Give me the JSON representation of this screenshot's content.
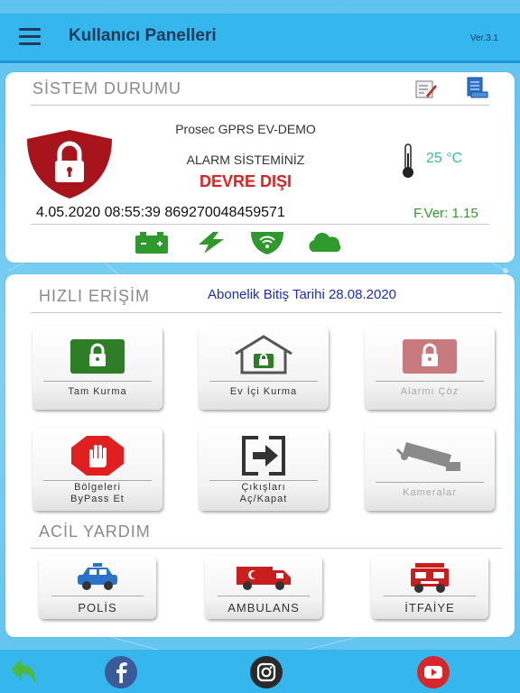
{
  "header": {
    "title": "Kullanıcı Panelleri",
    "version": "Ver.3.1"
  },
  "system_status": {
    "title": "SİSTEM DURUMU",
    "device_name": "Prosec GPRS EV-DEMO",
    "alarm_label": "ALARM SİSTEMİNİZ",
    "alarm_state": "DEVRE DIŞI",
    "temperature": "25 °C",
    "datetime_imei": "4.05.2020 08:55:39  869270048459571",
    "firmware": "F.Ver: 1.15",
    "icons": [
      "edit-icon",
      "report-icon",
      "battery-icon",
      "power-icon",
      "wifi-icon",
      "cloud-icon"
    ]
  },
  "quick_access": {
    "title": "HIZLI ERİŞİM",
    "expiry": "Abonelik Bitiş Tarihi 28.08.2020",
    "tiles": [
      {
        "label": "Tam Kurma"
      },
      {
        "label": "Ev İçi Kurma"
      },
      {
        "label": "Alarmı Çöz"
      },
      {
        "label_line1": "Bölgeleri",
        "label_line2": "ByPass Et"
      },
      {
        "label_line1": "Çıkışları",
        "label_line2": "Aç/Kapat"
      },
      {
        "label": "Kameralar"
      }
    ]
  },
  "emergency": {
    "title": "ACİL YARDIM",
    "buttons": [
      {
        "label": "POLİS"
      },
      {
        "label": "AMBULANS"
      },
      {
        "label": "İTFAİYE"
      }
    ]
  },
  "colors": {
    "accent": "#35b6ec",
    "alarm_red": "#e32020",
    "shield_red": "#a8141c",
    "arm_green": "#2e7d27",
    "temp_color": "#3fb8a6",
    "expiry_blue": "#1c2cc6"
  },
  "footer": {
    "icons": [
      "back-icon",
      "facebook-icon",
      "instagram-icon",
      "youtube-icon"
    ]
  }
}
